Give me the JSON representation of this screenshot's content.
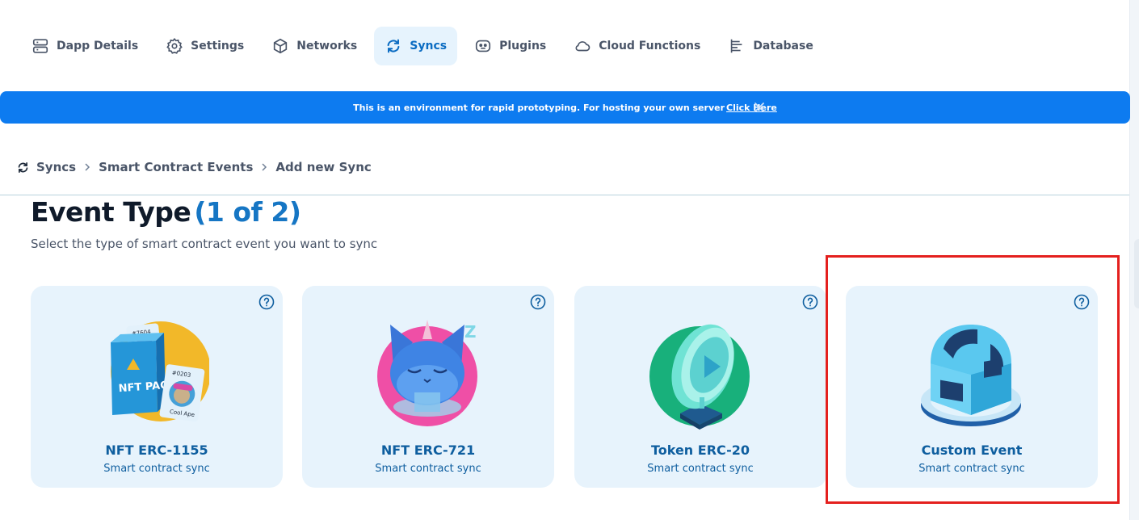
{
  "nav": {
    "items": [
      {
        "label": "Dapp Details",
        "icon": "server-icon"
      },
      {
        "label": "Settings",
        "icon": "gear-icon"
      },
      {
        "label": "Networks",
        "icon": "cube-icon"
      },
      {
        "label": "Syncs",
        "icon": "sync-icon",
        "active": true
      },
      {
        "label": "Plugins",
        "icon": "plugin-icon"
      },
      {
        "label": "Cloud Functions",
        "icon": "cloud-icon"
      },
      {
        "label": "Database",
        "icon": "database-icon"
      }
    ]
  },
  "banner": {
    "text": "This is an environment for rapid prototyping. For hosting your own server",
    "link": "Click Here",
    "color": "#0d7bf0"
  },
  "breadcrumb": {
    "items": [
      "Syncs",
      "Smart Contract Events",
      "Add new Sync"
    ]
  },
  "header": {
    "title": "Event Type",
    "step": "(1 of 2)",
    "subtitle": "Select the type of smart contract event you want to sync"
  },
  "cards": [
    {
      "name": "NFT ERC-1155",
      "desc": "Smart contract sync",
      "pack_label": "NFT PACK",
      "card_numbers": [
        "#7604",
        "#0203"
      ],
      "card_caption": "Cool Ape"
    },
    {
      "name": "NFT ERC-721",
      "desc": "Smart contract sync",
      "z_label": "Z"
    },
    {
      "name": "Token ERC-20",
      "desc": "Smart contract sync"
    },
    {
      "name": "Custom Event",
      "desc": "Smart contract sync"
    }
  ],
  "colors": {
    "accent": "#1676c4",
    "card_bg": "#e7f3fc",
    "highlight": "#e4201e"
  }
}
